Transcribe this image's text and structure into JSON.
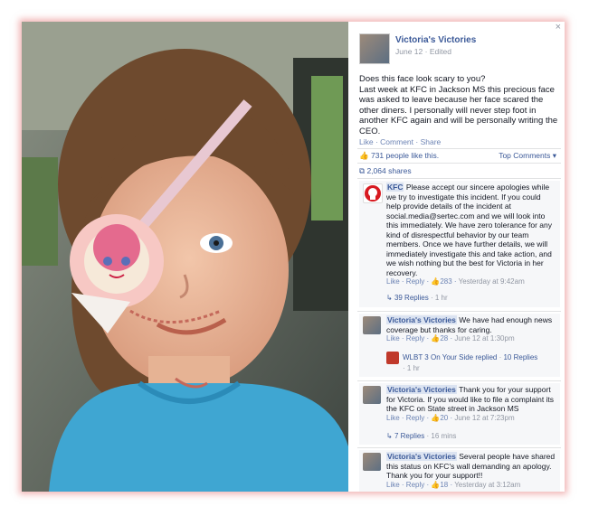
{
  "post": {
    "author": "Victoria's Victories",
    "date": "June 12",
    "edited": "Edited",
    "text": "Does this face look scary to you?\nLast week at KFC in Jackson MS this precious face was asked to leave because her face scared the other diners. I personally will never step foot in another KFC again and will be personally writing the CEO.",
    "actions": [
      "Like",
      "Comment",
      "Share"
    ],
    "likes": "731 people like this.",
    "top_comments": "Top Comments",
    "shares": "2,064 shares"
  },
  "comments": [
    {
      "author": "KFC",
      "text": "Please accept our sincere apologies while we try to investigate this incident. If you could help provide details of the incident at social.media@sertec.com and we will look into this immediately. We have zero tolerance for any kind of disrespectful behavior by our team members. Once we have further details, we will immediately investigate this and take action, and we wish nothing but the best for Victoria in her recovery.",
      "like": "Like",
      "reply": "Reply",
      "likes": "283",
      "time": "Yesterday at 9:42am",
      "replies": "39 Replies",
      "replies_time": "1 hr"
    },
    {
      "author": "Victoria's Victories",
      "text": "We have had enough news coverage but thanks for caring.",
      "like": "Like",
      "reply": "Reply",
      "likes": "28",
      "time": "June 12 at 1:30pm",
      "sub_author": "WLBT 3 On Your Side replied",
      "sub_replies": "10 Replies",
      "sub_time": "1 hr"
    },
    {
      "author": "Victoria's Victories",
      "text": "Thank you for your support for Victoria. If you would like to file a complaint its the KFC on State street in Jackson MS",
      "like": "Like",
      "reply": "Reply",
      "likes": "20",
      "time": "June 12 at 7:23pm",
      "replies": "7 Replies",
      "replies_time": "16 mins"
    },
    {
      "author": "Victoria's Victories",
      "text": "Several people have shared this status on KFC's wall demanding an apology. Thank you for your support!!",
      "like": "Like",
      "reply": "Reply",
      "likes": "18",
      "time": "Yesterday at 3:12am"
    }
  ],
  "close_label": "×"
}
